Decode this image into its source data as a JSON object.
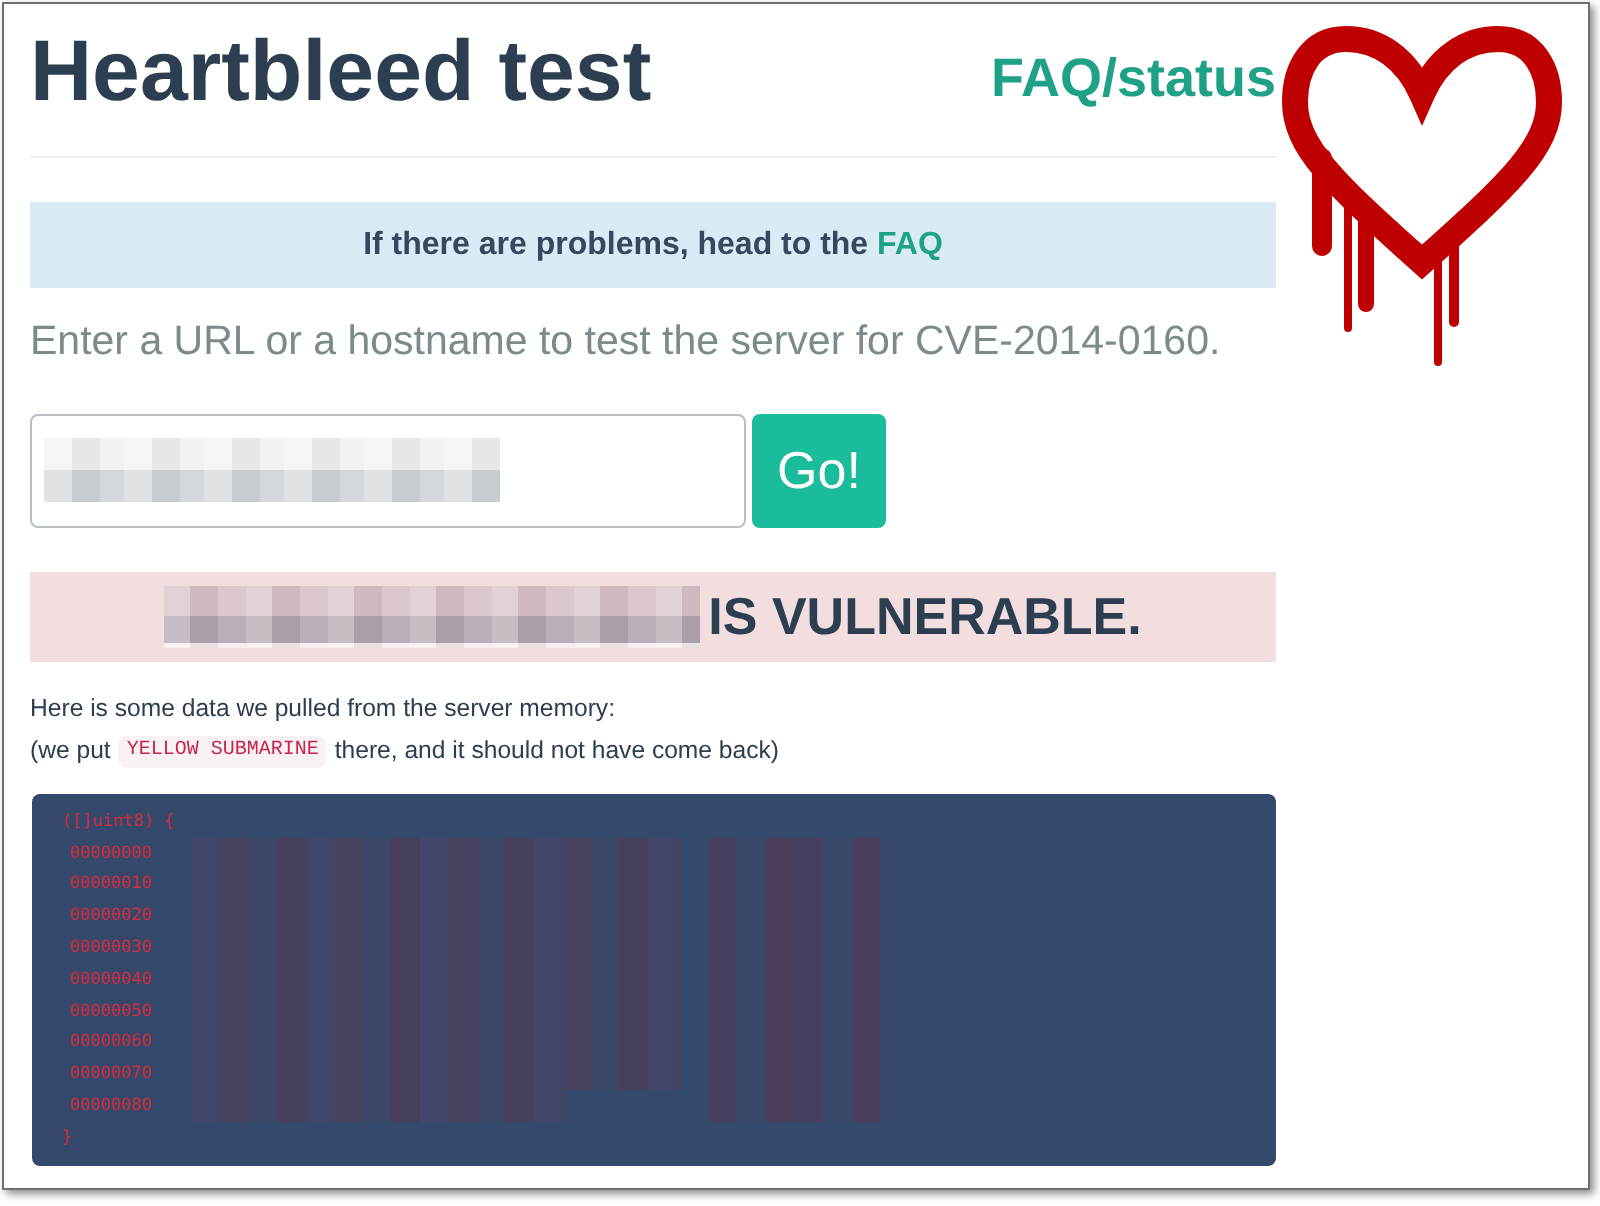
{
  "header": {
    "title": "Heartbleed test",
    "nav_link": "FAQ/status"
  },
  "notice": {
    "kind": "info",
    "text": "If there are problems, head to the",
    "link": "FAQ"
  },
  "lead": "Enter a URL or a hostname to test the server for CVE-2014-0160.",
  "form": {
    "button": "Go!"
  },
  "result": {
    "kind": "danger",
    "verdict": "IS VULNERABLE."
  },
  "explanation": {
    "line_1": "Here is some data we pulled from the server memory:",
    "line_2": {
      "before": "(we put",
      "code": "YELLOW SUBMARINE",
      "after": "there, and it should not have come back)"
    }
  },
  "memory_dump": {
    "header": "([]uint8) {",
    "offsets": [
      "00000000",
      "00000010",
      "00000020",
      "00000030",
      "00000040",
      "00000050",
      "00000060",
      "00000070",
      "00000080"
    ],
    "footer": "}"
  }
}
